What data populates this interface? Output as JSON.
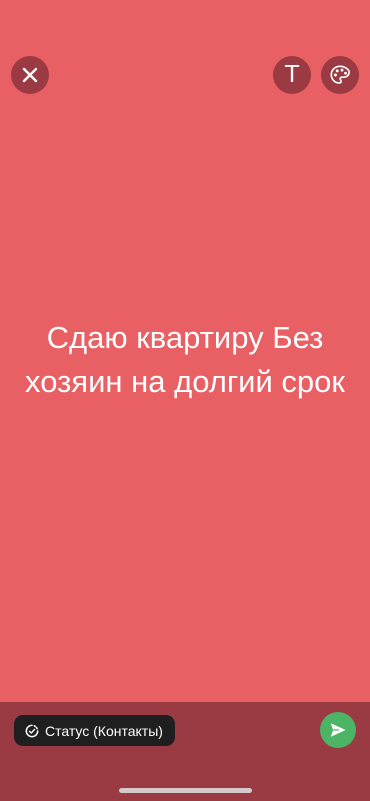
{
  "colors": {
    "background": "#e85f64",
    "icon_button": "#9b3a42",
    "bottom_bar": "#9a3b44",
    "privacy_chip": "#1f1f1f",
    "send_button": "#4bb465",
    "text": "#ffffff"
  },
  "toolbar": {
    "close_icon": "close-icon",
    "text_button_label": "T",
    "palette_icon": "palette-icon"
  },
  "status": {
    "text": "Сдаю квартиру Без хозяин на долгий срок"
  },
  "bottom": {
    "privacy_label": "Статус (Контакты)",
    "privacy_icon": "status-ring-icon",
    "send_icon": "send-icon"
  }
}
